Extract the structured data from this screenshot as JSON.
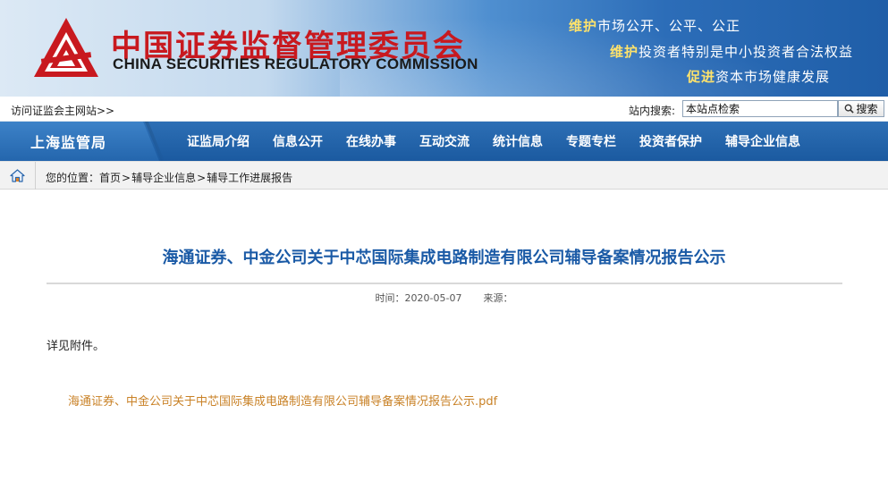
{
  "header": {
    "org_name_cn": "中国证券监督管理委员会",
    "org_name_en": "CHINA SECURITIES REGULATORY COMMISSION",
    "slogans": [
      {
        "highlight": "维护",
        "rest": "市场公开、公平、公正"
      },
      {
        "highlight": "维护",
        "rest": "投资者特别是中小投资者合法权益"
      },
      {
        "highlight": "促进",
        "rest": "资本市场健康发展"
      }
    ],
    "colors": {
      "brand_red": "#c8191f",
      "banner_blue": "#2c6db8",
      "slogan_highlight": "#ffe36b"
    }
  },
  "utilbar": {
    "main_site_link": "访问证监会主网站>>",
    "search_label": "站内搜索:",
    "search_value": "本站点检索",
    "search_button": "搜索"
  },
  "nav": {
    "bureau": "上海监管局",
    "items": [
      "证监局介绍",
      "信息公开",
      "在线办事",
      "互动交流",
      "统计信息",
      "专题专栏",
      "投资者保护",
      "辅导企业信息"
    ]
  },
  "breadcrumb": {
    "prefix": "您的位置：",
    "items": [
      "首页",
      "辅导企业信息",
      "辅导工作进展报告"
    ],
    "separator": ">"
  },
  "article": {
    "title": "海通证券、中金公司关于中芯国际集成电路制造有限公司辅导备案情况报告公示",
    "time_label": "时间：",
    "time_value": "2020-05-07",
    "source_label": "来源：",
    "source_value": "",
    "body": "详见附件。",
    "attachment": "海通证券、中金公司关于中芯国际集成电路制造有限公司辅导备案情况报告公示.pdf",
    "colors": {
      "title": "#1a5aa6",
      "attachment": "#c98227"
    }
  }
}
